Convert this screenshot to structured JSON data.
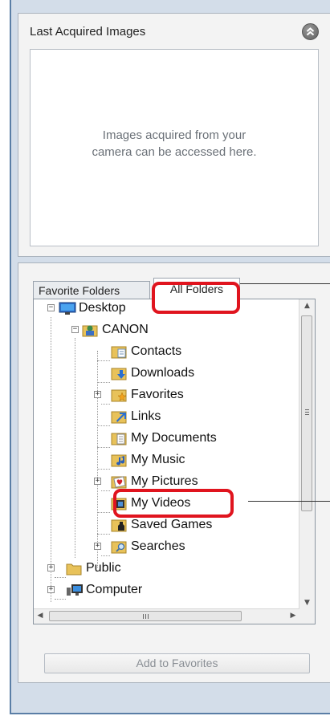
{
  "last_acquired": {
    "title": "Last Acquired Images",
    "message": "Images acquired from your\ncamera can be accessed here.",
    "collapse_icon": "double-chevron-up-icon"
  },
  "tabs": {
    "favorite_folders": "Favorite Folders",
    "all_folders": "All Folders",
    "selected": "All Folders"
  },
  "tree": {
    "nodes": [
      {
        "label": "Desktop",
        "icon": "desktop-icon",
        "expander": "minus"
      },
      {
        "label": "CANON",
        "icon": "user-folder-icon",
        "expander": "minus"
      },
      {
        "label": "Contacts",
        "icon": "contacts-folder-icon",
        "expander": ""
      },
      {
        "label": "Downloads",
        "icon": "downloads-folder-icon",
        "expander": ""
      },
      {
        "label": "Favorites",
        "icon": "favorites-folder-icon",
        "expander": "plus"
      },
      {
        "label": "Links",
        "icon": "links-folder-icon",
        "expander": ""
      },
      {
        "label": "My Documents",
        "icon": "documents-folder-icon",
        "expander": ""
      },
      {
        "label": "My Music",
        "icon": "music-folder-icon",
        "expander": ""
      },
      {
        "label": "My Pictures",
        "icon": "pictures-folder-icon",
        "expander": "plus"
      },
      {
        "label": "My Videos",
        "icon": "videos-folder-icon",
        "expander": ""
      },
      {
        "label": "Saved Games",
        "icon": "games-folder-icon",
        "expander": ""
      },
      {
        "label": "Searches",
        "icon": "search-folder-icon",
        "expander": "plus"
      },
      {
        "label": "Public",
        "icon": "folder-icon",
        "expander": "plus"
      },
      {
        "label": "Computer",
        "icon": "computer-icon",
        "expander": "plus"
      }
    ],
    "scroll_grip_glyph": "III"
  },
  "add_to_favorites": "Add to Favorites",
  "colors": {
    "highlight": "#e0141e",
    "frame": "#5a7ea6"
  }
}
